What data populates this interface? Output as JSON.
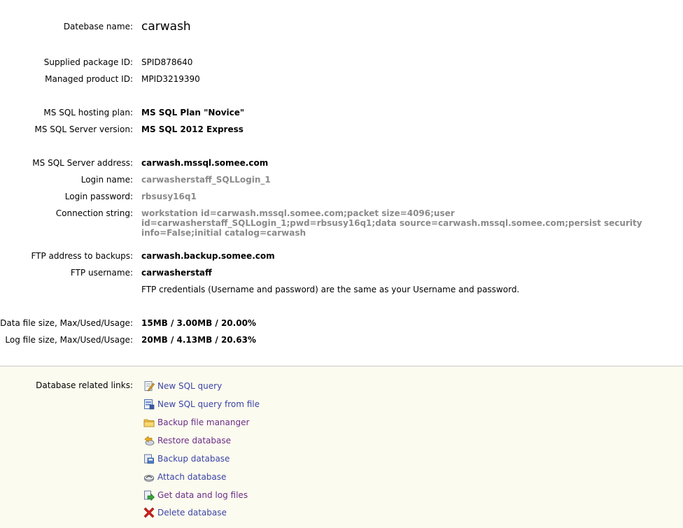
{
  "database": {
    "name_label": "Datebase name:",
    "name": "carwash"
  },
  "package": {
    "supplied_label": "Supplied package ID:",
    "supplied_value": "SPID878640",
    "managed_label": "Managed product ID:",
    "managed_value": "MPID3219390"
  },
  "plan": {
    "hosting_label": "MS SQL hosting plan:",
    "hosting_value": "MS SQL Plan \"Novice\"",
    "version_label": "MS SQL Server version:",
    "version_value": "MS SQL 2012 Express"
  },
  "server": {
    "address_label": "MS SQL Server address:",
    "address_value": "carwash.mssql.somee.com",
    "login_label": "Login name:",
    "login_value": "carwasherstaff_SQLLogin_1",
    "password_label": "Login password:",
    "password_value": "rbsusy16q1",
    "conn_label": "Connection string:",
    "conn_value": "workstation id=carwash.mssql.somee.com;packet size=4096;user id=carwasherstaff_SQLLogin_1;pwd=rbsusy16q1;data source=carwash.mssql.somee.com;persist security info=False;initial catalog=carwash"
  },
  "ftp": {
    "address_label": "FTP address to backups:",
    "address_value": "carwash.backup.somee.com",
    "user_label": "FTP username:",
    "user_value": "carwasherstaff",
    "note": "FTP credentials (Username and password) are the same as your Username and password."
  },
  "sizes": {
    "data_label": "Data file size, Max/Used/Usage:",
    "data_value": "15MB / 3.00MB / 20.00%",
    "log_label": "Log file size, Max/Used/Usage:",
    "log_value": "20MB / 4.13MB / 20.63%"
  },
  "links": {
    "label": "Database related links:",
    "items": [
      {
        "label": "New SQL query",
        "icon": "pencil-document-icon"
      },
      {
        "label": "New SQL query from file",
        "icon": "file-query-icon"
      },
      {
        "label": "Backup file mananger",
        "icon": "folder-icon"
      },
      {
        "label": "Restore database",
        "icon": "restore-icon"
      },
      {
        "label": "Backup database",
        "icon": "backup-icon"
      },
      {
        "label": "Attach database",
        "icon": "attach-icon"
      },
      {
        "label": "Get data and log files",
        "icon": "download-files-icon"
      },
      {
        "label": "Delete database",
        "icon": "delete-x-icon"
      }
    ]
  },
  "colors": {
    "link": "#3a44a8",
    "link_visited": "#6a2d8a",
    "muted_value": "#8a8a8a",
    "panel_bg": "#fcfbef",
    "delete": "#d42020"
  }
}
